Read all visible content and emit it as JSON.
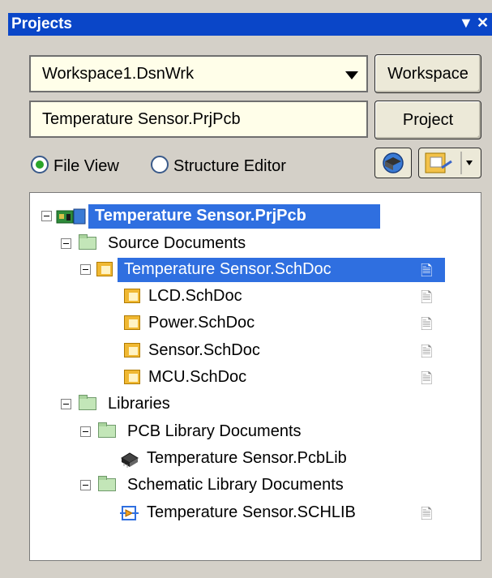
{
  "panel": {
    "title": "Projects",
    "menu_glyph": "▼",
    "close_glyph": "✕"
  },
  "workspace": {
    "value": "Workspace1.DsnWrk",
    "button_label": "Workspace"
  },
  "project": {
    "value": "Temperature Sensor.PrjPcb",
    "button_label": "Project"
  },
  "view_mode": {
    "file_view_label": "File View",
    "structure_editor_label": "Structure Editor",
    "selected": "File View"
  },
  "tree": {
    "project": "Temperature Sensor.PrjPcb",
    "source_documents": "Source Documents",
    "top_sheet": "Temperature Sensor.SchDoc",
    "sheets": [
      "LCD.SchDoc",
      "Power.SchDoc",
      "Sensor.SchDoc",
      "MCU.SchDoc"
    ],
    "libraries": "Libraries",
    "pcb_lib_docs": "PCB Library Documents",
    "pcb_lib": "Temperature Sensor.PcbLib",
    "sch_lib_docs": "Schematic Library Documents",
    "sch_lib": "Temperature Sensor.SCHLIB"
  },
  "colors": {
    "title_bar": "#0a46c8",
    "selection": "#2f6fe0",
    "field_background": "#fffee9"
  }
}
